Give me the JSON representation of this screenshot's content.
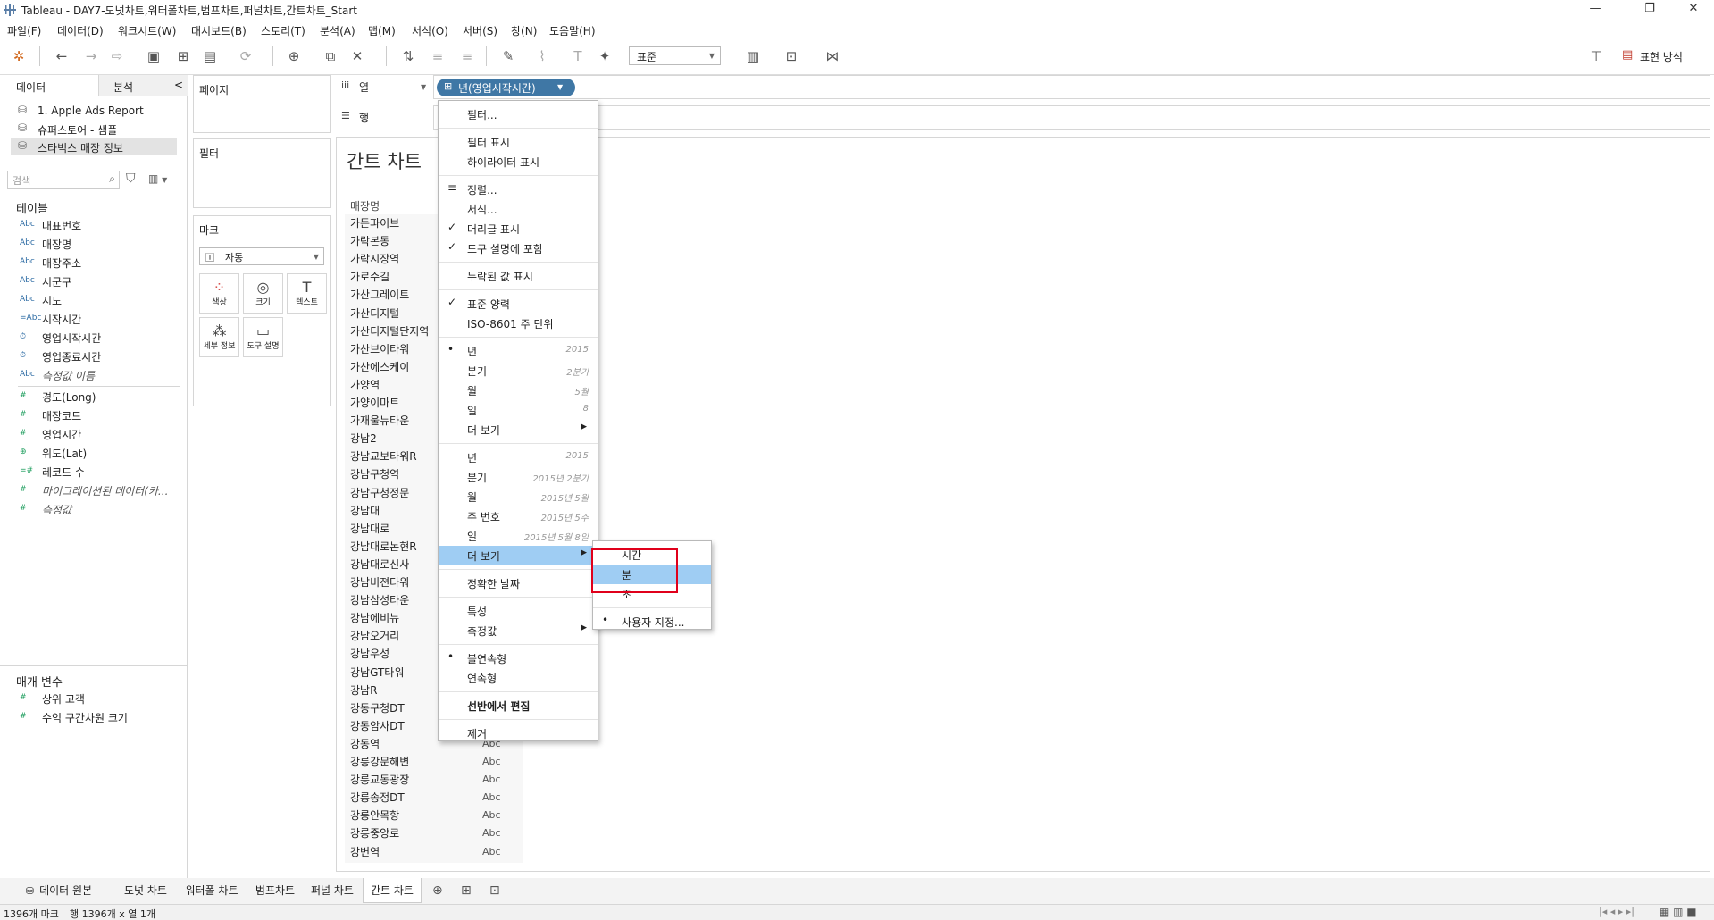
{
  "window": {
    "title": "Tableau - DAY7-도넛차트,워터폴차트,범프차트,퍼널차트,간트차트_Start",
    "min": "—",
    "max": "❐",
    "close": "✕"
  },
  "menu": [
    "파일(F)",
    "데이터(D)",
    "워크시트(W)",
    "대시보드(B)",
    "스토리(T)",
    "분석(A)",
    "맵(M)",
    "서식(O)",
    "서버(S)",
    "창(N)",
    "도움말(H)"
  ],
  "toolbar": {
    "fit": "표준",
    "show_me": "표현 방식"
  },
  "data_pane": {
    "tab_data": "데이터",
    "tab_analysis": "분석",
    "collapse": "<",
    "sources": [
      "1. Apple Ads Report",
      "슈퍼스토어 - 샘플",
      "스타벅스 매장 정보"
    ],
    "search_placeholder": "검색",
    "tables_header": "테이블",
    "dimensions": [
      {
        "icon": "Abc",
        "name": "대표번호"
      },
      {
        "icon": "Abc",
        "name": "매장명"
      },
      {
        "icon": "Abc",
        "name": "매장주소"
      },
      {
        "icon": "Abc",
        "name": "시군구"
      },
      {
        "icon": "Abc",
        "name": "시도"
      },
      {
        "icon": "=Abc",
        "name": "시작시간"
      },
      {
        "icon": "⏱",
        "name": "영업시작시간"
      },
      {
        "icon": "⏱",
        "name": "영업종료시간"
      },
      {
        "icon": "Abc",
        "name": "측정값 이름",
        "italic": true
      }
    ],
    "measures": [
      {
        "icon": "#",
        "name": "경도(Long)"
      },
      {
        "icon": "#",
        "name": "매장코드"
      },
      {
        "icon": "#",
        "name": "영업시간"
      },
      {
        "icon": "⊕",
        "name": "위도(Lat)"
      },
      {
        "icon": "=#",
        "name": "레코드 수"
      },
      {
        "icon": "#",
        "name": "마이그레이션된 데이터(카...",
        "italic": true
      },
      {
        "icon": "#",
        "name": "측정값",
        "italic": true
      }
    ],
    "params_header": "매개 변수",
    "params": [
      {
        "icon": "#",
        "name": "상위 고객"
      },
      {
        "icon": "#",
        "name": "수익 구간차원 크기"
      }
    ]
  },
  "shelves": {
    "pages": "페이지",
    "filters": "필터",
    "marks": "마크",
    "mark_type": "자동",
    "mark_buttons": [
      {
        "icon": "color-icon",
        "label": "색상"
      },
      {
        "icon": "size-icon",
        "label": "크기"
      },
      {
        "icon": "text-icon",
        "label": "텍스트"
      },
      {
        "icon": "detail-icon",
        "label": "세부 정보"
      },
      {
        "icon": "tooltip-icon",
        "label": "도구 설명"
      }
    ],
    "columns": "열",
    "rows": "행",
    "pill": "년(영업시작시간)"
  },
  "view": {
    "title": "간트 차트",
    "row_header": "매장명",
    "rows": [
      "가든파이브",
      "가락본동",
      "가락시장역",
      "가로수길",
      "가산그레이트",
      "가산디지털",
      "가산디지털단지역",
      "가산브이타워",
      "가산에스케이",
      "가양역",
      "가양이마트",
      "가재울뉴타운",
      "강남2",
      "강남교보타워R",
      "강남구청역",
      "강남구청정문",
      "강남대",
      "강남대로",
      "강남대로논현R",
      "강남대로신사",
      "강남비젼타워",
      "강남삼성타운",
      "강남에비뉴",
      "강남오거리",
      "강남우성",
      "강남GT타워",
      "강남R",
      "강동구청DT",
      "강동암사DT",
      "강동역",
      "강릉강문해변",
      "강릉교동광장",
      "강릉송정DT",
      "강릉안목항",
      "강릉중앙로",
      "강변역"
    ],
    "abc": "Abc"
  },
  "context_menu": [
    {
      "label": "필터...",
      "sep_after": true
    },
    {
      "label": "필터 표시"
    },
    {
      "label": "하이라이터 표시",
      "sep_after": true
    },
    {
      "label": "정렬...",
      "mark": "sort-icon"
    },
    {
      "label": "서식..."
    },
    {
      "label": "머리글 표시",
      "mark": "✓"
    },
    {
      "label": "도구 설명에 포함",
      "mark": "✓",
      "sep_after": true
    },
    {
      "label": "누락된 값 표시",
      "sep_after": true
    },
    {
      "label": "표준 양력",
      "mark": "✓"
    },
    {
      "label": "ISO-8601 주 단위",
      "sep_after": true
    },
    {
      "label": "년",
      "right": "2015",
      "mark": "•"
    },
    {
      "label": "분기",
      "right": "2분기"
    },
    {
      "label": "월",
      "right": "5월"
    },
    {
      "label": "일",
      "right": "8"
    },
    {
      "label": "더 보기",
      "submenu": true,
      "sep_after": true
    },
    {
      "label": "년",
      "right": "2015"
    },
    {
      "label": "분기",
      "right": "2015년 2분기"
    },
    {
      "label": "월",
      "right": "2015년 5월"
    },
    {
      "label": "주 번호",
      "right": "2015년 5주"
    },
    {
      "label": "일",
      "right": "2015년 5월 8일"
    },
    {
      "label": "더 보기",
      "submenu": true,
      "highlight": true,
      "sep_after": true
    },
    {
      "label": "정확한 날짜",
      "sep_after": true
    },
    {
      "label": "특성"
    },
    {
      "label": "측정값",
      "submenu": true,
      "sep_after": true
    },
    {
      "label": "불연속형",
      "mark": "•"
    },
    {
      "label": "연속형",
      "sep_after": true
    },
    {
      "label": "선반에서 편집",
      "bold": true,
      "sep_after": true
    },
    {
      "label": "제거"
    }
  ],
  "submenu": [
    {
      "label": "시간"
    },
    {
      "label": "분",
      "highlight": true
    },
    {
      "label": "초",
      "sep_after": true
    },
    {
      "label": "사용자 지정...",
      "mark": "•"
    }
  ],
  "tabs": [
    {
      "label": "데이터 원본",
      "icon": "datasource-icon"
    },
    {
      "label": "도넛 차트"
    },
    {
      "label": "워터폴 차트"
    },
    {
      "label": "범프차트"
    },
    {
      "label": "퍼널 차트"
    },
    {
      "label": "간트 차트",
      "active": true
    }
  ],
  "status": {
    "marks": "1396개 마크",
    "rows_cols": "행 1396개 x 열 1개"
  },
  "colors": {
    "pill": "#3f77a5",
    "highlight": "#9fcdf3",
    "annotation": "#e0001b"
  }
}
